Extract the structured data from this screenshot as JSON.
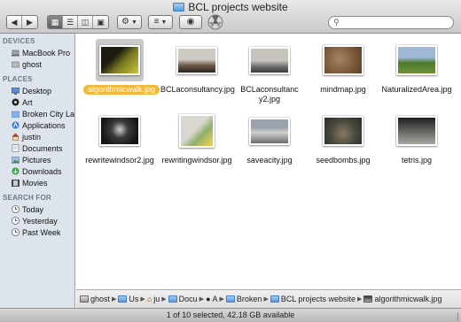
{
  "window": {
    "title": "BCL projects website"
  },
  "toolbar": {
    "back_icon": "back-arrow-icon",
    "forward_icon": "forward-arrow-icon",
    "view_modes": [
      "icon-view-icon",
      "list-view-icon",
      "column-view-icon",
      "coverflow-view-icon"
    ],
    "search_placeholder": ""
  },
  "sidebar": {
    "sections": [
      {
        "title": "DEVICES",
        "items": [
          {
            "label": "MacBook Pro",
            "icon": "laptop-icon"
          },
          {
            "label": "ghost",
            "icon": "disk-icon"
          }
        ]
      },
      {
        "title": "PLACES",
        "items": [
          {
            "label": "Desktop",
            "icon": "desktop-icon"
          },
          {
            "label": "Art",
            "icon": "disc-icon"
          },
          {
            "label": "Broken City Lab",
            "icon": "folder-icon"
          },
          {
            "label": "Applications",
            "icon": "applications-icon"
          },
          {
            "label": "justin",
            "icon": "home-icon"
          },
          {
            "label": "Documents",
            "icon": "documents-icon"
          },
          {
            "label": "Pictures",
            "icon": "pictures-icon"
          },
          {
            "label": "Downloads",
            "icon": "downloads-icon"
          },
          {
            "label": "Movies",
            "icon": "movies-icon"
          }
        ]
      },
      {
        "title": "SEARCH FOR",
        "items": [
          {
            "label": "Today",
            "icon": "clock-icon"
          },
          {
            "label": "Yesterday",
            "icon": "clock-icon"
          },
          {
            "label": "Past Week",
            "icon": "clock-icon"
          }
        ]
      }
    ]
  },
  "files": [
    {
      "name": "algorithmicwalk.jpg",
      "selected": true,
      "colors": [
        "#1d1a10",
        "#7a7a20",
        "#c9c43a"
      ]
    },
    {
      "name": "BCLaconsultancy.jpg",
      "selected": false,
      "colors": [
        "#cfcbc4",
        "#6b5a45",
        "#2a2420"
      ]
    },
    {
      "name": "BCLaconsultancy2.jpg",
      "selected": false,
      "colors": [
        "#c7c3bd",
        "#6e6e6e",
        "#3a3a3a"
      ]
    },
    {
      "name": "mindmap.jpg",
      "selected": false,
      "colors": [
        "#7d5a3a",
        "#a78564",
        "#5c3e26"
      ]
    },
    {
      "name": "NaturalizedArea.jpg",
      "selected": false,
      "colors": [
        "#9eb8d6",
        "#4c7a2c",
        "#6f8f3a"
      ]
    },
    {
      "name": "rewritewindsor2.jpg",
      "selected": false,
      "colors": [
        "#141414",
        "#3b3b3b",
        "#cfcfcf"
      ]
    },
    {
      "name": "rewritingwindsor.jpg",
      "selected": false,
      "colors": [
        "#d9d7cf",
        "#8fb06b",
        "#f2d54a"
      ]
    },
    {
      "name": "saveacity.jpg",
      "selected": false,
      "colors": [
        "#9aa2ad",
        "#cfd0cf",
        "#6b6a66"
      ]
    },
    {
      "name": "seedbombs.jpg",
      "selected": false,
      "colors": [
        "#4a4a40",
        "#8a7a60",
        "#2b2b25"
      ]
    },
    {
      "name": "tetris.jpg",
      "selected": false,
      "colors": [
        "#1f1d1d",
        "#6c6a66",
        "#a8a6a0"
      ]
    }
  ],
  "pathbar": [
    {
      "label": "ghost"
    },
    {
      "label": "Us"
    },
    {
      "label": "ju"
    },
    {
      "label": "Docu"
    },
    {
      "label": "A"
    },
    {
      "label": "Broken"
    },
    {
      "label": "BCL projects website"
    },
    {
      "label": "algorithmicwalk.jpg"
    }
  ],
  "status": {
    "text": "1 of 10 selected, 42.18 GB available"
  }
}
